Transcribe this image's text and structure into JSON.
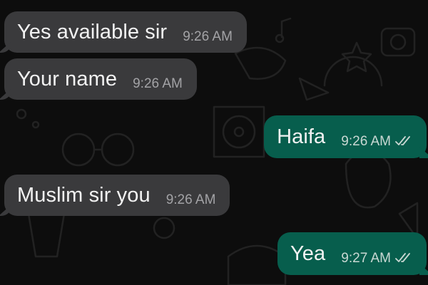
{
  "messages": [
    {
      "direction": "incoming",
      "text": "Yes available sir",
      "time": "9:26 AM"
    },
    {
      "direction": "incoming",
      "text": "Your name",
      "time": "9:26 AM"
    },
    {
      "direction": "outgoing",
      "text": "Haifa",
      "time": "9:26 AM",
      "status": "read"
    },
    {
      "direction": "incoming",
      "text": "Muslim sir you",
      "time": "9:26 AM"
    },
    {
      "direction": "outgoing",
      "text": "Yea",
      "time": "9:27 AM",
      "status": "read"
    }
  ],
  "colors": {
    "background": "#0d0d0d",
    "incoming_bubble": "#3a3a3c",
    "outgoing_bubble": "#075e4d",
    "text": "#f2f2f2",
    "timestamp": "#a3a3a6"
  },
  "icons": {
    "read_status": "double-check-icon",
    "wallpaper": "doodle-pattern"
  }
}
